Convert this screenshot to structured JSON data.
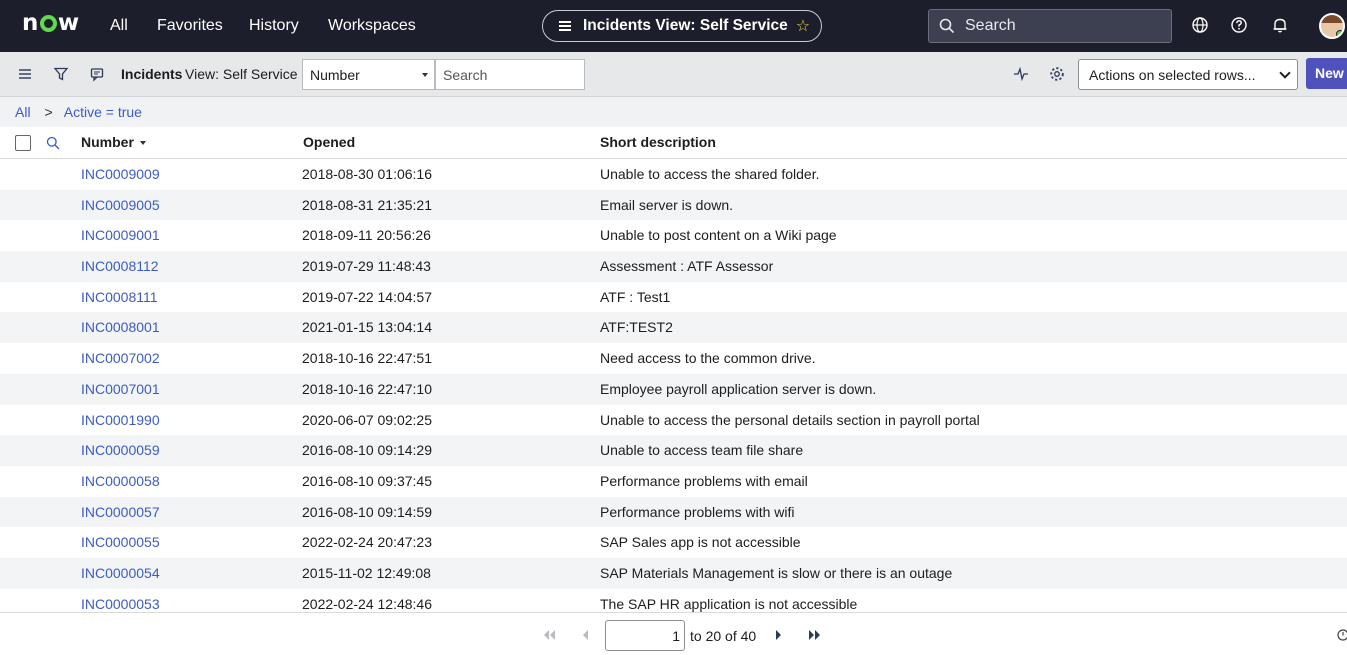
{
  "topnav": {
    "logo": "now",
    "menu": [
      "All",
      "Favorites",
      "History",
      "Workspaces"
    ],
    "context_title": "Incidents View: Self Service",
    "search_placeholder": "Search"
  },
  "toolbar": {
    "title": "Incidents",
    "view": "View: Self Service",
    "field_select": "Number",
    "search_placeholder": "Search",
    "actions_select": "Actions on selected rows...",
    "new_label": "New"
  },
  "breadcrumb": {
    "root": "All",
    "separator": ">",
    "filter": "Active = true"
  },
  "table": {
    "columns": [
      "Number",
      "Opened",
      "Short description"
    ],
    "rows": [
      {
        "number": "INC0009009",
        "opened": "2018-08-30 01:06:16",
        "desc": "Unable to access the shared folder."
      },
      {
        "number": "INC0009005",
        "opened": "2018-08-31 21:35:21",
        "desc": "Email server is down."
      },
      {
        "number": "INC0009001",
        "opened": "2018-09-11 20:56:26",
        "desc": "Unable to post content on a Wiki page"
      },
      {
        "number": "INC0008112",
        "opened": "2019-07-29 11:48:43",
        "desc": "Assessment : ATF Assessor"
      },
      {
        "number": "INC0008111",
        "opened": "2019-07-22 14:04:57",
        "desc": "ATF : Test1"
      },
      {
        "number": "INC0008001",
        "opened": "2021-01-15 13:04:14",
        "desc": "ATF:TEST2"
      },
      {
        "number": "INC0007002",
        "opened": "2018-10-16 22:47:51",
        "desc": "Need access to the common drive."
      },
      {
        "number": "INC0007001",
        "opened": "2018-10-16 22:47:10",
        "desc": "Employee payroll application server is down."
      },
      {
        "number": "INC0001990",
        "opened": "2020-06-07 09:02:25",
        "desc": "Unable to access the personal details section in payroll portal"
      },
      {
        "number": "INC0000059",
        "opened": "2016-08-10 09:14:29",
        "desc": "Unable to access team file share"
      },
      {
        "number": "INC0000058",
        "opened": "2016-08-10 09:37:45",
        "desc": "Performance problems with email"
      },
      {
        "number": "INC0000057",
        "opened": "2016-08-10 09:14:59",
        "desc": "Performance problems with wifi"
      },
      {
        "number": "INC0000055",
        "opened": "2022-02-24 20:47:23",
        "desc": "SAP Sales app is not accessible"
      },
      {
        "number": "INC0000054",
        "opened": "2015-11-02 12:49:08",
        "desc": "SAP Materials Management is slow or there is an outage"
      },
      {
        "number": "INC0000053",
        "opened": "2022-02-24 12:48:46",
        "desc": "The SAP HR application is not accessible"
      }
    ]
  },
  "pagination": {
    "current": "1",
    "range_text": "to 20 of 40"
  },
  "colors": {
    "nav_bg": "#1c1e2b",
    "link": "#3b5cc4",
    "primary_button": "#4f52bd",
    "logo_green": "#62d84e"
  }
}
